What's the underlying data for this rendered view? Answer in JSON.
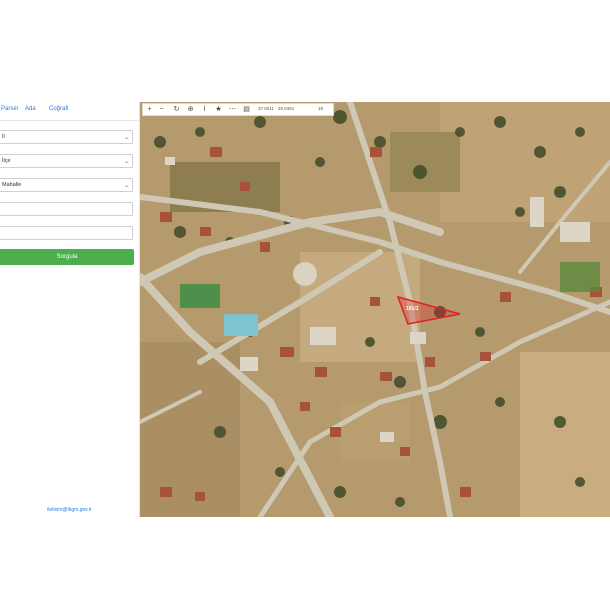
{
  "tabs": [
    "Parsel",
    "Ada",
    "Coğrafi"
  ],
  "selects": [
    {
      "value": "İl"
    },
    {
      "value": "İlçe"
    },
    {
      "value": "Mahalle"
    }
  ],
  "inputs": [
    {
      "value": ""
    },
    {
      "value": ""
    }
  ],
  "query_button": "Sorgula",
  "footer_link": "iletisim@tkgm.gov.tr",
  "toolbar": {
    "coords": "37.0211 · 28.0361",
    "zoom": "18"
  },
  "map": {
    "parcel_label": "101/1",
    "highlight_color": "#e0202a",
    "road_color": "#cfc8b4"
  }
}
